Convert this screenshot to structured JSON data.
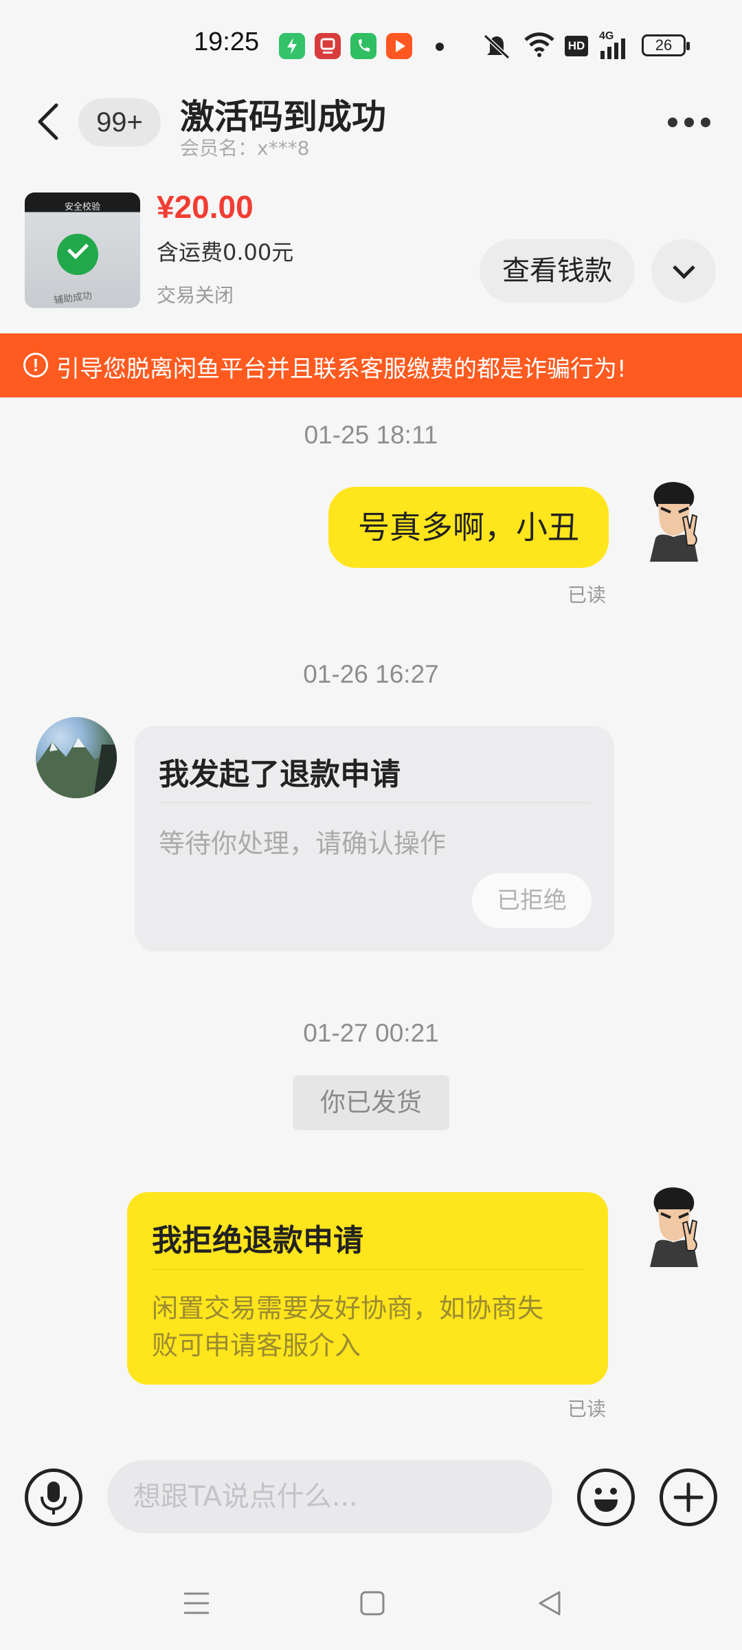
{
  "status_bar": {
    "time": "19:25",
    "battery": "26",
    "hd_label": "HD",
    "network": "4G",
    "icons": [
      "green-app-icon",
      "red-app-icon",
      "phone-app-icon",
      "video-app-icon",
      "dot-icon",
      "mute-icon",
      "wifi-icon",
      "hd-icon",
      "signal-icon",
      "battery-icon"
    ]
  },
  "header": {
    "unread_badge": "99+",
    "title": "激活码到成功",
    "subtitle": "会员名：x***8"
  },
  "product": {
    "thumb_top_text": "安全校验",
    "thumb_bottom_text": "辅助成功",
    "price": "¥20.00",
    "shipping": "含运费0.00元",
    "status": "交易关闭",
    "view_money_label": "查看钱款"
  },
  "warning": {
    "icon": "!",
    "text": "引导您脱离闲鱼平台并且联系客服缴费的都是诈骗行为!"
  },
  "chat": {
    "ts1": "01-25 18:11",
    "msg1": "号真多啊，小丑",
    "read1": "已读",
    "ts2": "01-26 16:27",
    "refund_card": {
      "title": "我发起了退款申请",
      "subtitle": "等待你处理，请确认操作",
      "status": "已拒绝"
    },
    "ts3": "01-27 00:21",
    "system_notice": "你已发货",
    "reject_card": {
      "title": "我拒绝退款申请",
      "body_line1": "闲置交易需要友好协商，如协商失",
      "body_line2": "败可申请客服介入"
    },
    "read2": "已读"
  },
  "input": {
    "placeholder": "想跟TA说点什么..."
  },
  "colors": {
    "accent_yellow": "#ffe51c",
    "warning_orange": "#ff5a1f",
    "price_red": "#f23d33",
    "background": "#f6f6f6"
  }
}
